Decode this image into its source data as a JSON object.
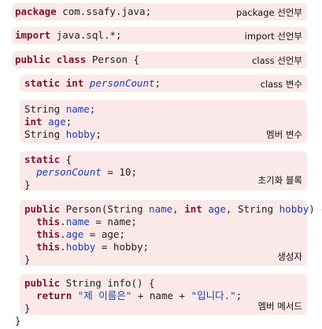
{
  "package_block": {
    "kw": "package",
    "rest": " com.ssafy.java;",
    "label": "package 선언부"
  },
  "import_block": {
    "kw": "import",
    "rest": " java.sql.*;",
    "label": "import 선언부"
  },
  "class_block": {
    "kw1": "public",
    "kw2": "class",
    "rest": " Person {",
    "label": "class 선언부"
  },
  "static_var_block": {
    "kw1": "static",
    "kw2": "int",
    "name": "personCount",
    "rest": ";",
    "label": "class 변수"
  },
  "member_var_block": {
    "line1_type": "String ",
    "line1_name": "name",
    "line1_end": ";",
    "line2_kw": "int",
    "line2_name": "age",
    "line2_end": ";",
    "line3_type": "String ",
    "line3_name": "hobby",
    "line3_end": ";",
    "label": "멤버 변수"
  },
  "static_init_block": {
    "kw": "static",
    "open": " {",
    "name": "personCount",
    "assign": " = 10;",
    "close": "}",
    "label": "초기화 블록"
  },
  "constructor_block": {
    "kw": "public",
    "sig1": " Person(String ",
    "p1": "name",
    "sep1": ", ",
    "p2kw": "int",
    "sp": " ",
    "p2": "age",
    "sig2": ", String ",
    "p3": "hobby",
    "sig3": ") {",
    "this_kw": "this",
    "dot": ".",
    "f1": "name",
    "a1": " = name;",
    "f2": "age",
    "a2": " = age;",
    "f3": "hobby",
    "a3": " = hobby;",
    "close": "}",
    "label": "생성자"
  },
  "method_block": {
    "kw": "public",
    "sig": " String info() {",
    "ret_kw": "return",
    "s1": "\"제 이름은\"",
    "mid": " + name + ",
    "s2": "\"입니다.\"",
    "end": ";",
    "close": "}",
    "label": "멤버 메서드"
  },
  "class_close": "}"
}
